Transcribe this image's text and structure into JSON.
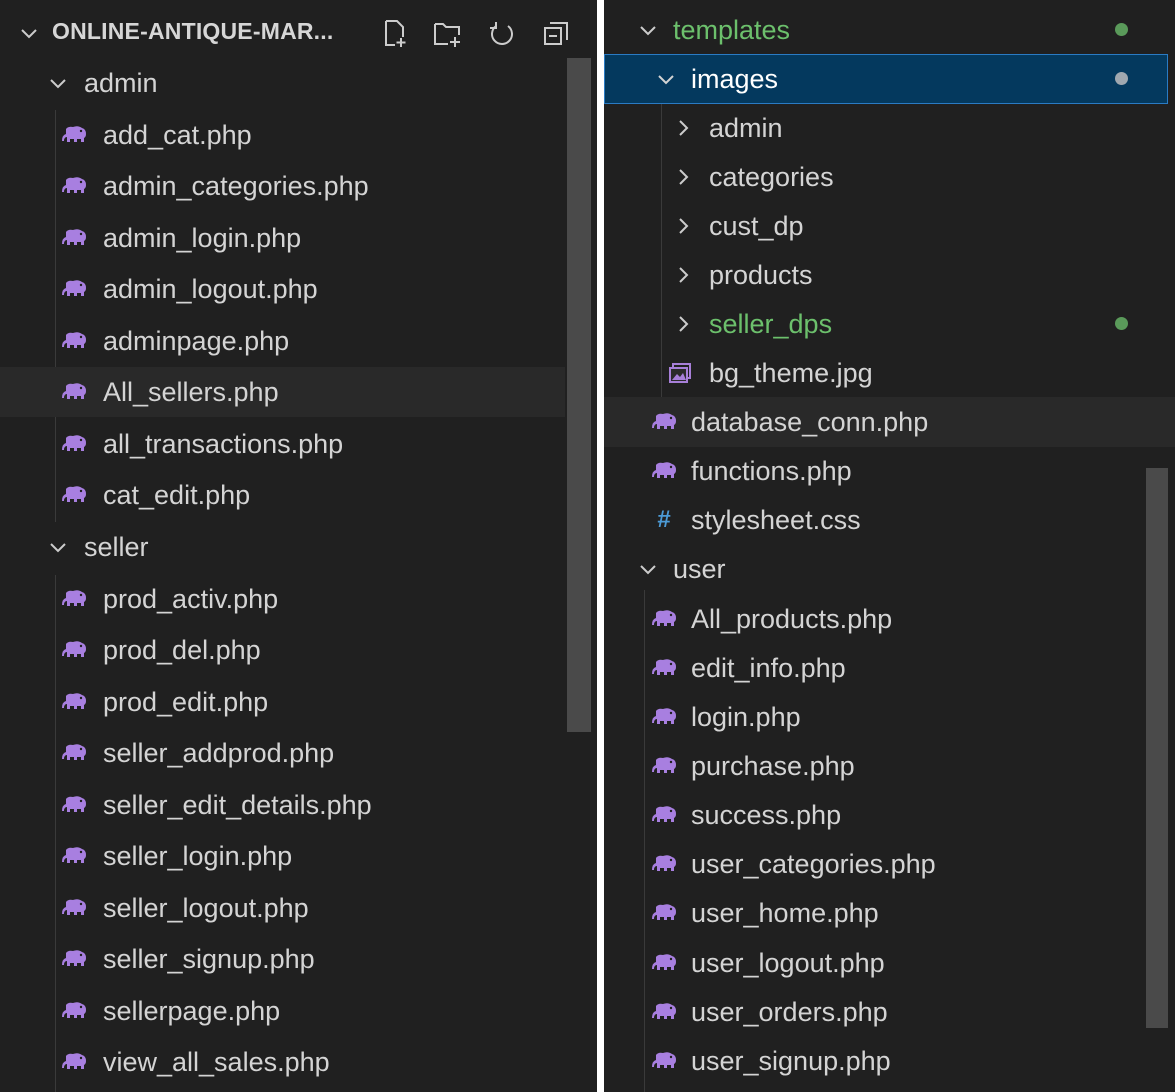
{
  "left": {
    "root_title": "ONLINE-ANTIQUE-MAR...",
    "toolbar": {
      "new_file": "new-file-icon",
      "new_folder": "new-folder-icon",
      "refresh": "refresh-icon",
      "collapse": "collapse-all-icon"
    },
    "folders": [
      {
        "name": "admin",
        "files": [
          "add_cat.php",
          "admin_categories.php",
          "admin_login.php",
          "admin_logout.php",
          "adminpage.php",
          "All_sellers.php",
          "all_transactions.php",
          "cat_edit.php"
        ]
      },
      {
        "name": "seller",
        "files": [
          "prod_activ.php",
          "prod_del.php",
          "prod_edit.php",
          "seller_addprod.php",
          "seller_edit_details.php",
          "seller_login.php",
          "seller_logout.php",
          "seller_signup.php",
          "sellerpage.php",
          "view_all_sales.php"
        ]
      }
    ]
  },
  "right": {
    "templates_folder": "templates",
    "images_folder": "images",
    "image_subfolders": [
      "admin",
      "categories",
      "cust_dp",
      "products",
      "seller_dps"
    ],
    "image_file": "bg_theme.jpg",
    "template_files": [
      "database_conn.php",
      "functions.php",
      "stylesheet.css"
    ],
    "user_folder": "user",
    "user_files": [
      "All_products.php",
      "edit_info.php",
      "login.php",
      "purchase.php",
      "success.php",
      "user_categories.php",
      "user_home.php",
      "user_logout.php",
      "user_orders.php",
      "user_signup.php"
    ]
  },
  "colors": {
    "background": "#202020",
    "text": "#d4d4d4",
    "git_modified_text": "#6cc06c",
    "git_dot": "#5a9a5a",
    "selected_bg": "#04395e",
    "php_icon": "#a87fe0",
    "css_icon": "#4c9bd6"
  }
}
